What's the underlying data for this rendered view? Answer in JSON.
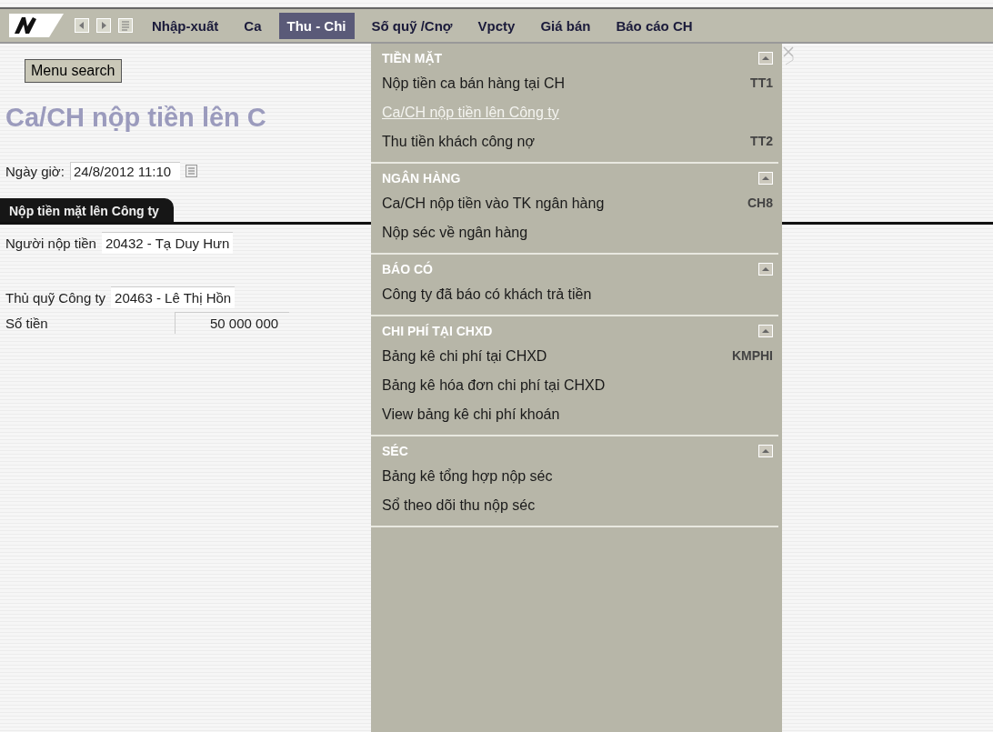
{
  "menubar": {
    "items": [
      {
        "label": "Nhập-xuất",
        "selected": false
      },
      {
        "label": "Ca",
        "selected": false
      },
      {
        "label": "Thu - Chi",
        "selected": true
      },
      {
        "label": "Số quỹ /Cnợ",
        "selected": false
      },
      {
        "label": "Vpcty",
        "selected": false
      },
      {
        "label": "Giá bán",
        "selected": false
      },
      {
        "label": "Báo cáo CH",
        "selected": false
      }
    ]
  },
  "menu_search": {
    "label": "Menu search"
  },
  "page": {
    "title": "Ca/CH nộp tiền lên C",
    "date_label": "Ngày giờ:",
    "date_value": "24/8/2012 11:10",
    "tab": "Nộp tiền mặt lên Công ty",
    "fields": [
      {
        "label": "Người nộp tiền",
        "value": "20432 - Tạ Duy Hưn",
        "kind": "text"
      },
      {
        "label": "Thủ quỹ Công ty",
        "value": "20463 - Lê Thị Hồn",
        "kind": "text"
      },
      {
        "label": "Số tiền",
        "value": "50 000 000",
        "kind": "amount"
      }
    ]
  },
  "dropdown": {
    "sections": [
      {
        "title": "TIỀN MẶT",
        "items": [
          {
            "label": "Nộp tiền ca bán hàng tại CH",
            "shortcut": "TT1",
            "selected": false
          },
          {
            "label": "Ca/CH nộp tiền lên Công ty",
            "selected": true
          },
          {
            "label": "Thu tiền khách công nợ",
            "shortcut": "TT2",
            "selected": false
          }
        ]
      },
      {
        "title": "NGÂN HÀNG",
        "items": [
          {
            "label": "Ca/CH nộp tiền vào TK ngân hàng",
            "shortcut": "CH8",
            "selected": false
          },
          {
            "label": "Nộp séc về ngân hàng",
            "selected": false
          }
        ]
      },
      {
        "title": "BÁO CÓ",
        "items": [
          {
            "label": "Công ty đã báo có khách trả tiền",
            "selected": false
          }
        ]
      },
      {
        "title": "CHI PHÍ TẠI CHXD",
        "items": [
          {
            "label": "Bảng kê chi phí tại CHXD",
            "shortcut": "KMPHI",
            "selected": false
          },
          {
            "label": "Bảng kê hóa đơn chi phí tại CHXD",
            "selected": false
          },
          {
            "label": "View bảng kê chi phí khoán",
            "selected": false
          }
        ]
      },
      {
        "title": "SÉC",
        "items": [
          {
            "label": "Bảng kê tổng hợp nộp séc",
            "selected": false
          },
          {
            "label": "Sổ theo dõi thu nộp séc",
            "selected": false
          }
        ]
      }
    ]
  }
}
